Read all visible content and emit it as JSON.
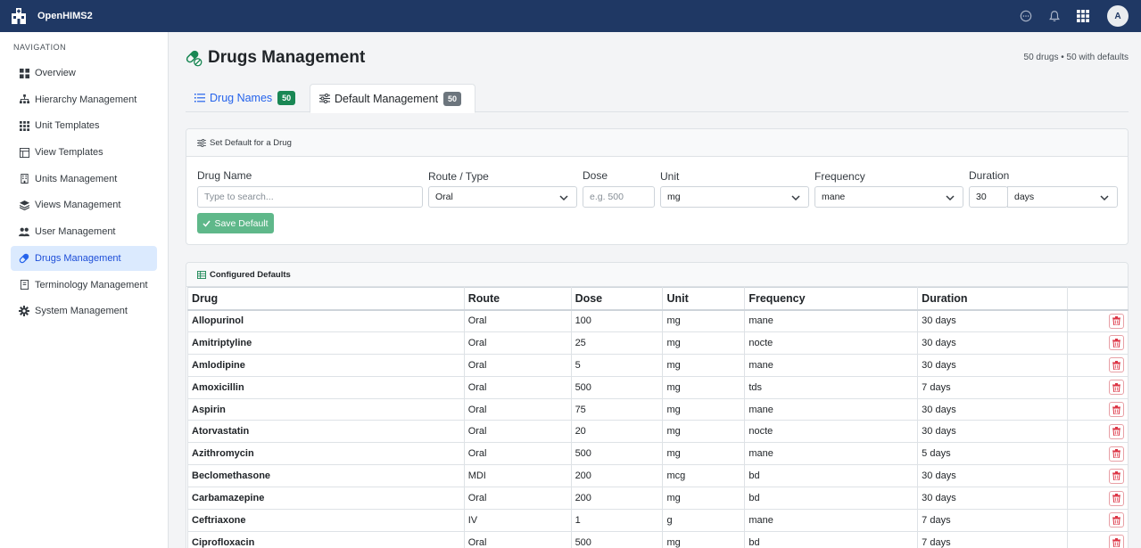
{
  "app": {
    "name": "OpenHIMS2",
    "user_initial": "A"
  },
  "topbar": {
    "icons": [
      "chat-icon",
      "bell-icon",
      "apps-grid-icon"
    ]
  },
  "sidebar": {
    "heading": "NAVIGATION",
    "items": [
      {
        "label": "Overview",
        "icon": "dashboard-icon"
      },
      {
        "label": "Hierarchy Management",
        "icon": "hierarchy-icon"
      },
      {
        "label": "Unit Templates",
        "icon": "grid-icon"
      },
      {
        "label": "View Templates",
        "icon": "layout-icon"
      },
      {
        "label": "Units Management",
        "icon": "building-icon"
      },
      {
        "label": "Views Management",
        "icon": "layers-icon"
      },
      {
        "label": "User Management",
        "icon": "users-icon"
      },
      {
        "label": "Drugs Management",
        "icon": "capsule-icon",
        "active": true
      },
      {
        "label": "Terminology Management",
        "icon": "book-icon"
      },
      {
        "label": "System Management",
        "icon": "gear-icon"
      }
    ]
  },
  "page": {
    "title": "Drugs Management",
    "stats": "50 drugs • 50 with defaults",
    "tabs": [
      {
        "label": "Drug Names",
        "count": "50",
        "icon": "list-icon"
      },
      {
        "label": "Default Management",
        "count": "50",
        "icon": "sliders-icon",
        "active": true
      }
    ]
  },
  "form": {
    "title": "Set Default for a Drug",
    "drug_name": {
      "label": "Drug Name",
      "placeholder": "Type to search..."
    },
    "route": {
      "label": "Route / Type",
      "value": "Oral"
    },
    "dose": {
      "label": "Dose",
      "placeholder": "e.g. 500"
    },
    "unit": {
      "label": "Unit",
      "value": "mg"
    },
    "frequency": {
      "label": "Frequency",
      "value": "mane"
    },
    "duration": {
      "label": "Duration",
      "value": "30",
      "unit_value": "days"
    },
    "save_label": "Save Default"
  },
  "table": {
    "title": "Configured Defaults",
    "columns": [
      "Drug",
      "Route",
      "Dose",
      "Unit",
      "Frequency",
      "Duration",
      ""
    ],
    "rows": [
      [
        "Allopurinol",
        "Oral",
        "100",
        "mg",
        "mane",
        "30 days"
      ],
      [
        "Amitriptyline",
        "Oral",
        "25",
        "mg",
        "nocte",
        "30 days"
      ],
      [
        "Amlodipine",
        "Oral",
        "5",
        "mg",
        "mane",
        "30 days"
      ],
      [
        "Amoxicillin",
        "Oral",
        "500",
        "mg",
        "tds",
        "7 days"
      ],
      [
        "Aspirin",
        "Oral",
        "75",
        "mg",
        "mane",
        "30 days"
      ],
      [
        "Atorvastatin",
        "Oral",
        "20",
        "mg",
        "nocte",
        "30 days"
      ],
      [
        "Azithromycin",
        "Oral",
        "500",
        "mg",
        "mane",
        "5 days"
      ],
      [
        "Beclomethasone",
        "MDI",
        "200",
        "mcg",
        "bd",
        "30 days"
      ],
      [
        "Carbamazepine",
        "Oral",
        "200",
        "mg",
        "bd",
        "30 days"
      ],
      [
        "Ceftriaxone",
        "IV",
        "1",
        "g",
        "mane",
        "7 days"
      ],
      [
        "Ciprofloxacin",
        "Oral",
        "500",
        "mg",
        "bd",
        "7 days"
      ]
    ]
  },
  "colors": {
    "topbar": "#1f3864",
    "accent": "#2563eb",
    "badge_green": "#198754",
    "save": "#5fb88a",
    "delete": "#dc3545"
  }
}
